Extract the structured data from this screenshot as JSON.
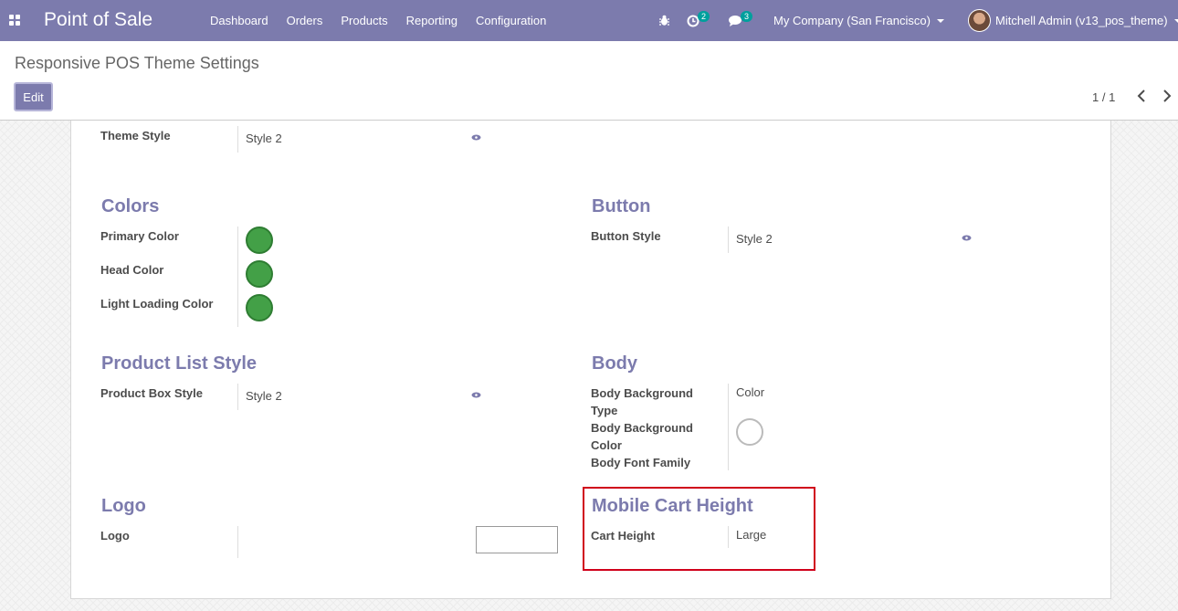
{
  "navbar": {
    "app_title": "Point of Sale",
    "menu": [
      "Dashboard",
      "Orders",
      "Products",
      "Reporting",
      "Configuration"
    ],
    "activity_count": "2",
    "message_count": "3",
    "company": "My Company (San Francisco)",
    "user": "Mitchell Admin (v13_pos_theme)"
  },
  "control": {
    "breadcrumb": "Responsive POS Theme Settings",
    "edit_label": "Edit",
    "pager": "1 / 1"
  },
  "form": {
    "theme_style": {
      "label": "Theme Style",
      "value": "Style 2"
    },
    "colors": {
      "title": "Colors",
      "primary_label": "Primary Color",
      "head_label": "Head Color",
      "light_loading_label": "Light Loading Color",
      "swatch_color": "#43a047"
    },
    "button": {
      "title": "Button",
      "style_label": "Button Style",
      "style_value": "Style 2"
    },
    "product_list": {
      "title": "Product List Style",
      "box_label": "Product Box Style",
      "box_value": "Style 2"
    },
    "body": {
      "title": "Body",
      "bg_type_label_1": "Body Background",
      "bg_type_label_2": "Type",
      "bg_type_value": "Color",
      "bg_color_label_1": "Body Background",
      "bg_color_label_2": "Color",
      "font_family_label": "Body Font Family"
    },
    "logo": {
      "title": "Logo",
      "label": "Logo"
    },
    "mobile_cart": {
      "title": "Mobile Cart Height",
      "label": "Cart Height",
      "value": "Large"
    }
  },
  "colors": {
    "navbar": "#7c7bad",
    "accent": "#7c7bad",
    "highlight": "#d0021b"
  }
}
